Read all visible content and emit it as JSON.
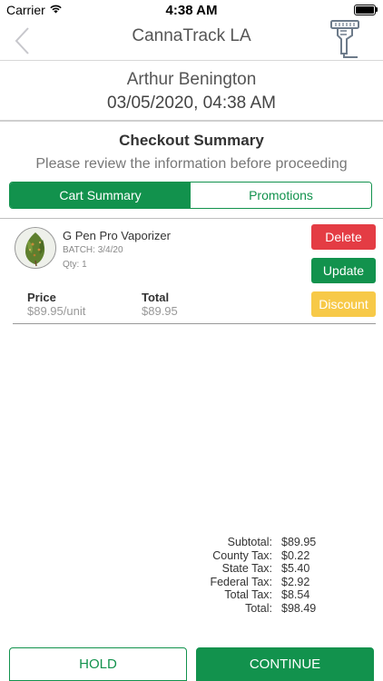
{
  "status_bar": {
    "carrier": "Carrier",
    "time": "4:38 AM"
  },
  "nav": {
    "title": "CannaTrack LA",
    "back_icon": "chevron-left-icon",
    "scanner_icon": "barcode-scanner-icon"
  },
  "customer": {
    "name": "Arthur Benington",
    "datetime": "03/05/2020, 04:38 AM"
  },
  "summary": {
    "title": "Checkout Summary",
    "subtitle": "Please review the information before proceeding"
  },
  "tabs": [
    {
      "label": "Cart Summary",
      "active": true
    },
    {
      "label": "Promotions",
      "active": false
    }
  ],
  "cart_item": {
    "name": "G Pen Pro Vaporizer",
    "batch": "BATCH: 3/4/20",
    "qty": "Qty: 1",
    "price_label": "Price",
    "price_value": "$89.95/unit",
    "total_label": "Total",
    "total_value": "$89.95",
    "actions": {
      "delete": "Delete",
      "update": "Update",
      "discount": "Discount"
    }
  },
  "totals": [
    {
      "label": "Subtotal:",
      "value": "$89.95"
    },
    {
      "label": "County Tax:",
      "value": "$0.22"
    },
    {
      "label": "State Tax:",
      "value": "$5.40"
    },
    {
      "label": "Federal Tax:",
      "value": "$2.92"
    },
    {
      "label": "Total Tax:",
      "value": "$8.54"
    },
    {
      "label": "Total:",
      "value": "$98.49"
    }
  ],
  "footer": {
    "hold": "HOLD",
    "continue": "CONTINUE"
  },
  "colors": {
    "brand_green": "#12924d",
    "delete_red": "#e43c44",
    "discount_yellow": "#f7c948"
  }
}
